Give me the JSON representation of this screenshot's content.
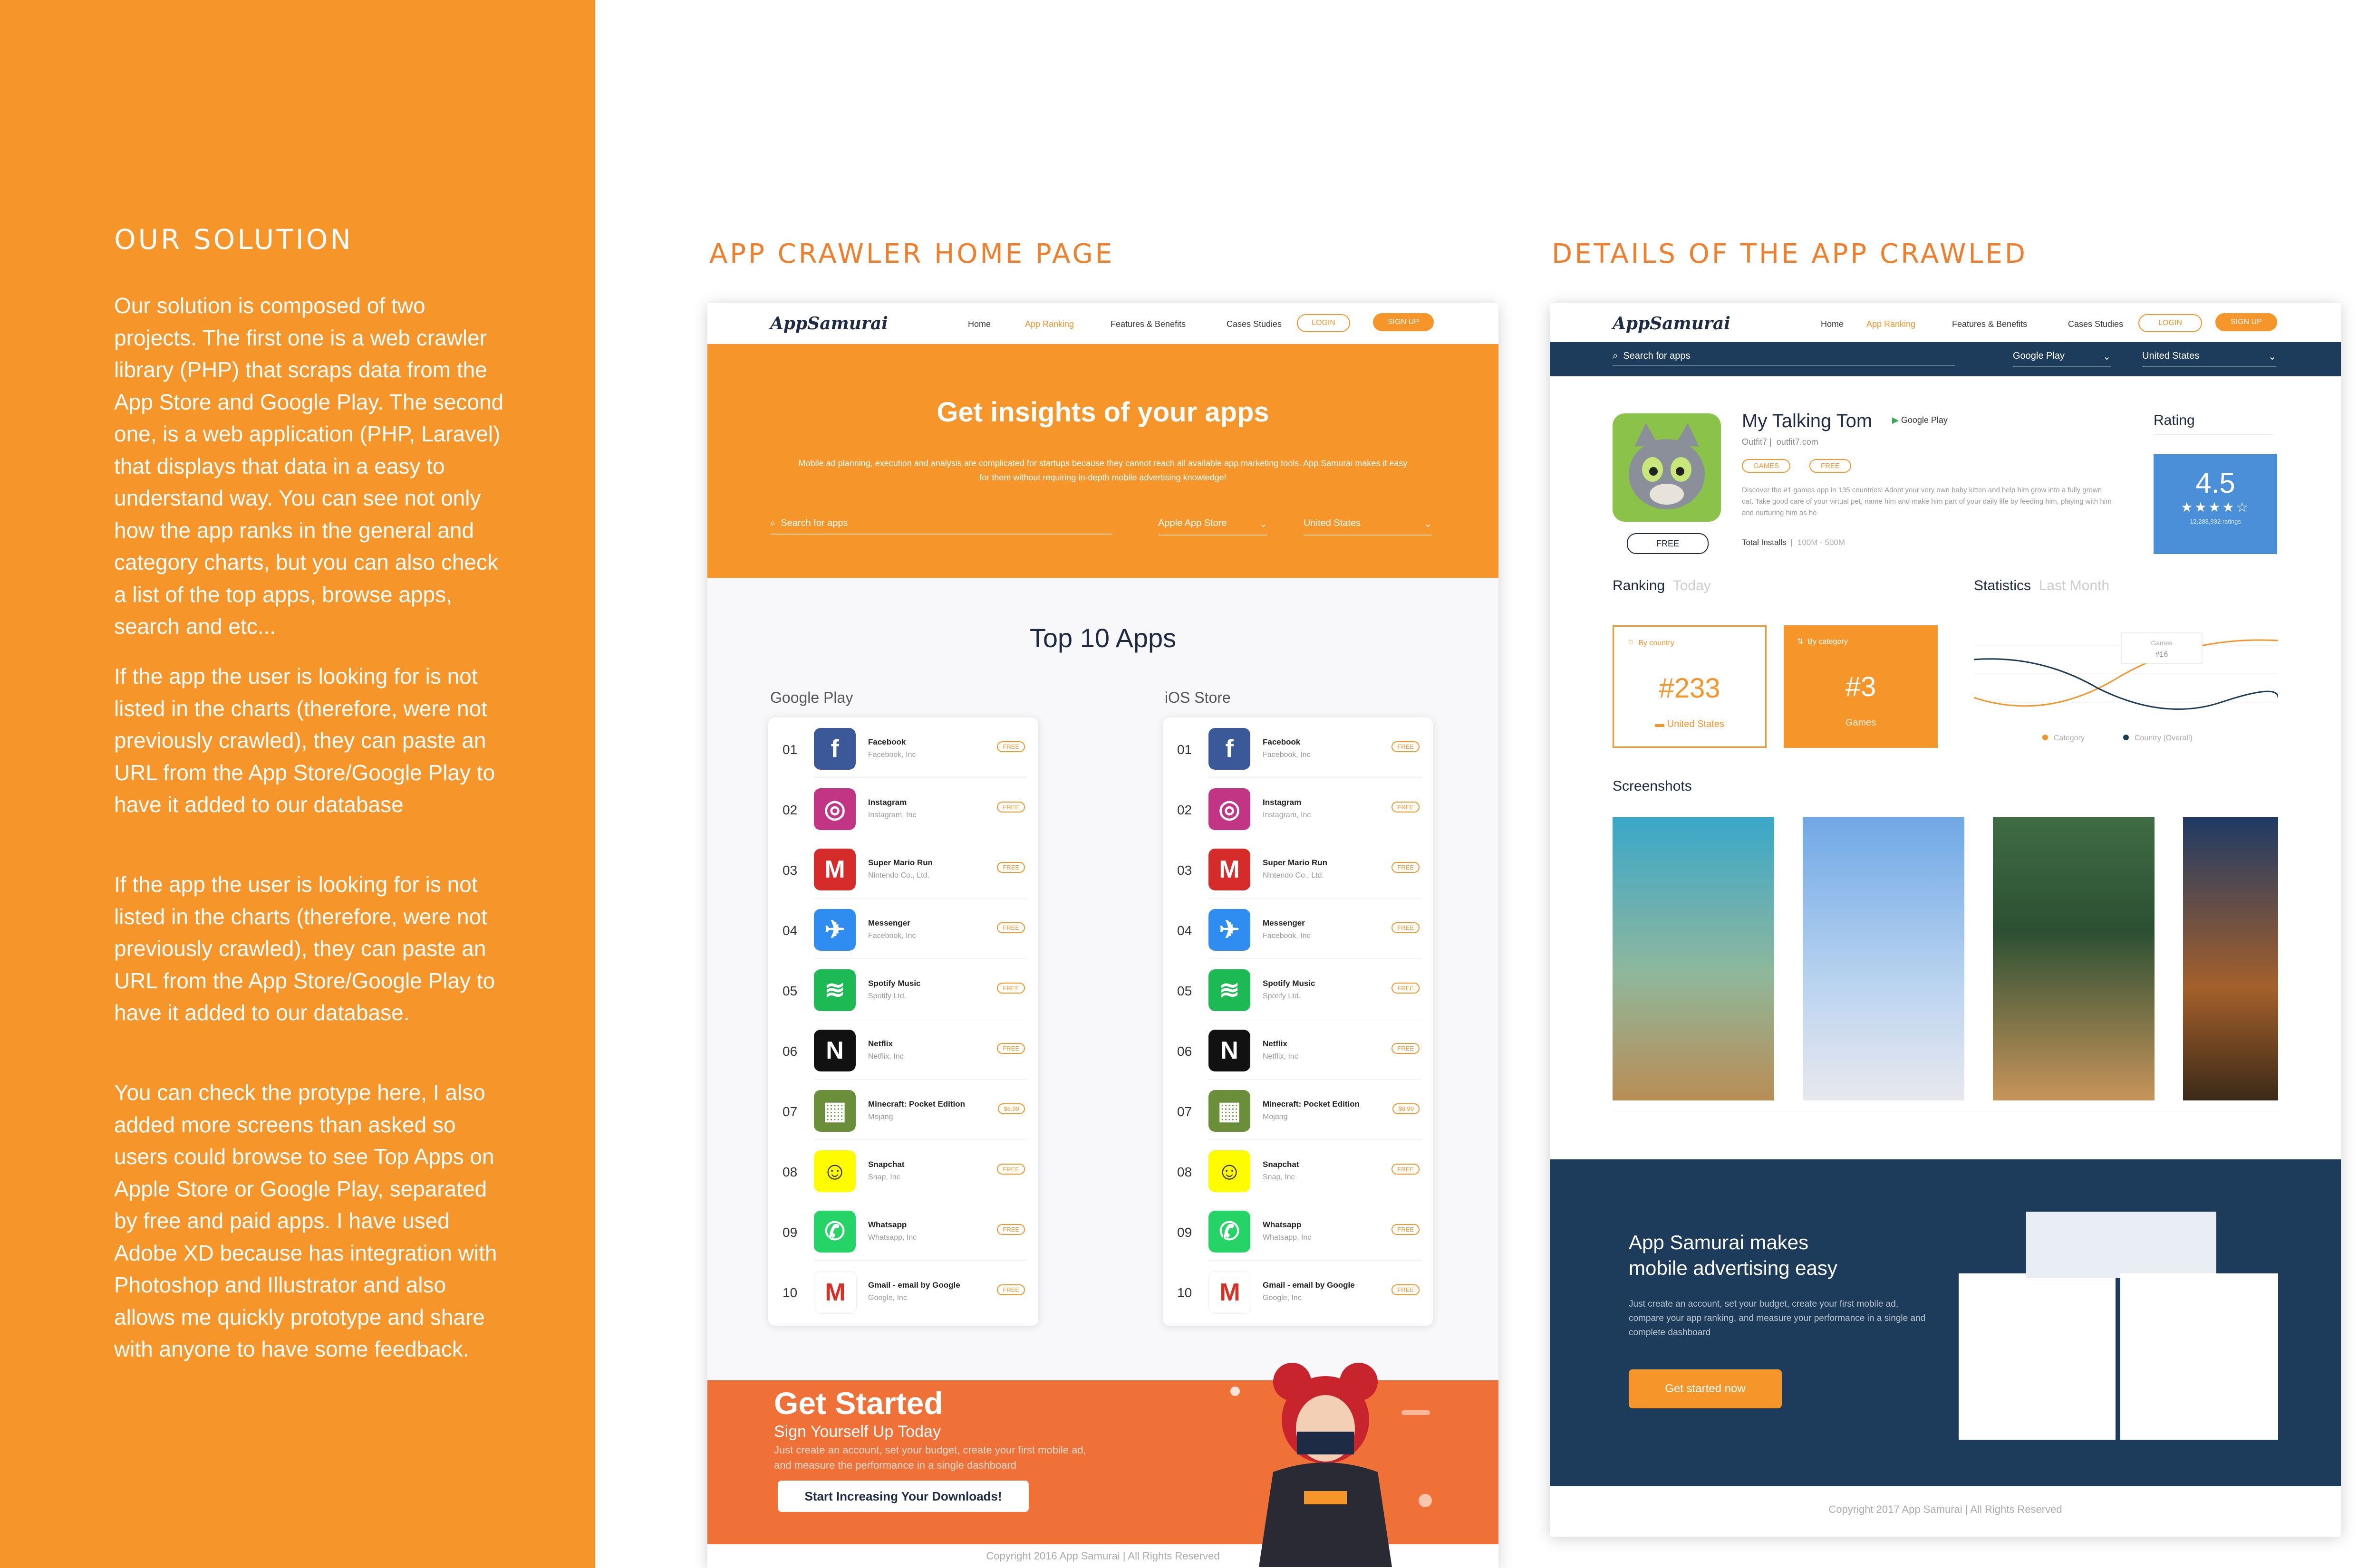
{
  "solution": {
    "title": "OUR SOLUTION",
    "paragraphs": [
      "Our solution is composed of two projects. The first one is a web crawler library (PHP) that scraps data from the App Store and Google Play. The second one, is a web application (PHP, Laravel) that displays that data in a easy to understand way. You can see not only how the app ranks in the general and category charts, but you can also check a list of the top apps, browse apps, search and etc...",
      "If the app the user is looking for is not listed in the charts (therefore, were not previously crawled), they can paste an URL from the App Store/Google Play to have it added to our database",
      "If the app the user is looking for is not listed in the charts (therefore, were not previously crawled), they can paste an URL from the App Store/Google Play to have it added to our database.",
      "You can check the protype here, I also added more screens than asked so users could browse to see Top Apps on Apple Store or Google Play, separated by free and paid apps. I have used Adobe XD because has integration with Photoshop and Illustrator and also allows me quickly prototype and share with anyone to have some feedback."
    ]
  },
  "sections": {
    "home": "APP CRAWLER HOME PAGE",
    "details": "DETAILS OF THE APP CRAWLED"
  },
  "nav": {
    "logo": "AppSamurai",
    "items": [
      "Home",
      "App Ranking",
      "Features & Benefits",
      "Cases Studies"
    ],
    "login": "LOGIN",
    "signup": "SIGN UP"
  },
  "home": {
    "hero_title": "Get insights of your apps",
    "hero_sub": "Mobile ad planning, execution and analysis are complicated for startups because they cannot reach all available app marketing tools. App Samurai makes it easy for them without requiring in-depth mobile advertising knowledge!",
    "search_placeholder": "Search for apps",
    "store_select": "Apple App Store",
    "country_select": "United States",
    "top10_title": "Top 10  Apps",
    "google_label": "Google Play",
    "ios_label": "iOS Store",
    "apps": [
      {
        "num": "01",
        "name": "Facebook",
        "dev": "Facebook, Inc",
        "price": "FREE",
        "color": "#3b5998",
        "glyph": "f"
      },
      {
        "num": "02",
        "name": "Instagram",
        "dev": "Instagram, Inc",
        "price": "FREE",
        "color": "#c13584",
        "glyph": "◎"
      },
      {
        "num": "03",
        "name": "Super Mario Run",
        "dev": "Nintendo Co., Ltd.",
        "price": "FREE",
        "color": "#d62b2b",
        "glyph": "M"
      },
      {
        "num": "04",
        "name": "Messenger",
        "dev": "Facebook, Inc",
        "price": "FREE",
        "color": "#2f8cf0",
        "glyph": "✈"
      },
      {
        "num": "05",
        "name": "Spotify Music",
        "dev": "Spotify Ltd.",
        "price": "FREE",
        "color": "#1db954",
        "glyph": "≋"
      },
      {
        "num": "06",
        "name": "Netflix",
        "dev": "Netflix, Inc",
        "price": "FREE",
        "color": "#111111",
        "glyph": "N"
      },
      {
        "num": "07",
        "name": "Minecraft: Pocket Edition",
        "dev": "Mojang",
        "price": "$6.99",
        "color": "#6b8e3a",
        "glyph": "▦"
      },
      {
        "num": "08",
        "name": "Snapchat",
        "dev": "Snap, Inc",
        "price": "FREE",
        "color": "#fffc00",
        "glyph": "☺"
      },
      {
        "num": "09",
        "name": "Whatsapp",
        "dev": "Whatsapp, Inc",
        "price": "FREE",
        "color": "#25d366",
        "glyph": "✆"
      },
      {
        "num": "10",
        "name": "Gmail - email by Google",
        "dev": "Google, Inc",
        "price": "FREE",
        "color": "#ffffff",
        "glyph": "M"
      }
    ],
    "gs_title": "Get Started",
    "gs_sub": "Sign Yourself Up Today",
    "gs_text": "Just create an account, set your budget, create your first mobile ad, and measure the performance in a single dashboard",
    "gs_button": "Start Increasing Your Downloads!",
    "copyright": "Copyright 2016 App Samurai | All Rights Reserved"
  },
  "details": {
    "search_placeholder": "Search for apps",
    "store_select": "Google Play",
    "country_select": "United States",
    "app_name": "My Talking Tom",
    "store_badge": "Google Play",
    "developer": "Outfit7",
    "website": "outfit7.com",
    "tags": [
      "GAMES",
      "FREE"
    ],
    "description": "Discover the #1 games app in 135 countries! Adopt your very own baby kitten and help him grow into a fully grown cat. Take good care of your virtual pet, name him and make him part of your daily life by feeding him, playing with him and nurturing him as he",
    "install_label": "Total Installs",
    "install_value": "100M - 500M",
    "icon_button": "FREE",
    "rating_label": "Rating",
    "rating_value": "4.5",
    "rating_count": "12,288,932 ratings",
    "ranking_label": "Ranking",
    "ranking_period": "Today",
    "by_country_label": "By country",
    "by_country_value": "#233",
    "by_country_sub": "United States",
    "by_category_label": "By category",
    "by_category_value": "#3",
    "by_category_sub": "Games",
    "stats_label": "Statistics",
    "stats_period": "Last Month",
    "stats_tooltip_label": "Games",
    "stats_tooltip_value": "#16",
    "legend": [
      "Category",
      "Country (Overall)"
    ],
    "screenshots_label": "Screenshots",
    "promo_title_1": "App Samurai makes",
    "promo_title_2": "mobile advertising easy",
    "promo_text": "Just create an account, set your budget, create your first mobile ad, compare your app ranking, and measure your performance in a single and complete dashboard",
    "promo_button": "Get started now",
    "copyright": "Copyright 2017 App Samurai | All Rights Reserved"
  },
  "colors": {
    "orange": "#F6962A",
    "navy": "#1d3b5a"
  }
}
